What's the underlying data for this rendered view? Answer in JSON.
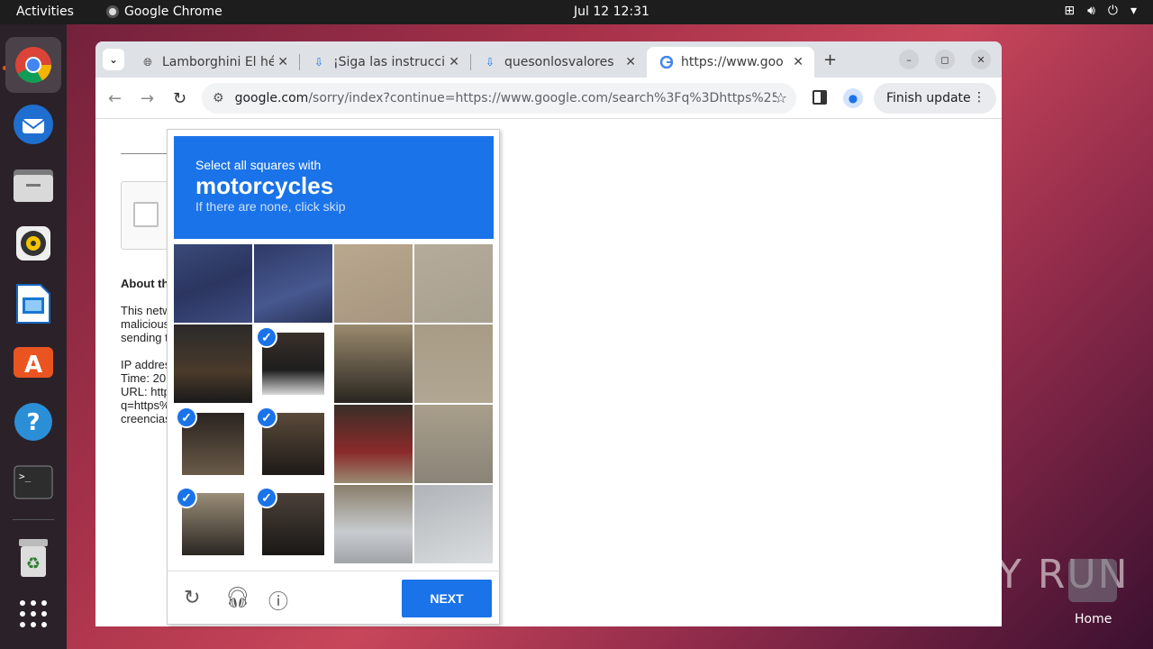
{
  "topbar": {
    "activities": "Activities",
    "app_name": "Google Chrome",
    "clock": "Jul 12  12:31"
  },
  "tabs": [
    {
      "title": "Lamborghini El hé",
      "favicon": "globe-icon"
    },
    {
      "title": "¡Siga las instruccio",
      "favicon": "download-icon"
    },
    {
      "title": "quesonlosvalores",
      "favicon": "download-icon"
    },
    {
      "title": "https://www.goo",
      "favicon": "google-icon"
    }
  ],
  "toolbar": {
    "url_host": "google.com",
    "url_path": "/sorry/index?continue=https://www.google.com/search%3Fq%3Dhttps%253A...",
    "finish_update": "Finish update"
  },
  "page": {
    "about": "About th",
    "p1": [
      "This netw",
      "malicious",
      "sending t"
    ],
    "p2": [
      "IP addres",
      "Time: 20",
      "URL: http",
      "q=https%",
      "creencias"
    ]
  },
  "captcha": {
    "instruction": "Select all squares with",
    "target": "motorcycles",
    "hint": "If there are none, click skip",
    "next_label": "NEXT",
    "selected": [
      5,
      8,
      9,
      12,
      13
    ]
  },
  "desktop": {
    "watermark": "ANY RUN",
    "home_label": "Home"
  },
  "colors": {
    "accent": "#1a73e8",
    "ubuntu_orange": "#e95420"
  }
}
